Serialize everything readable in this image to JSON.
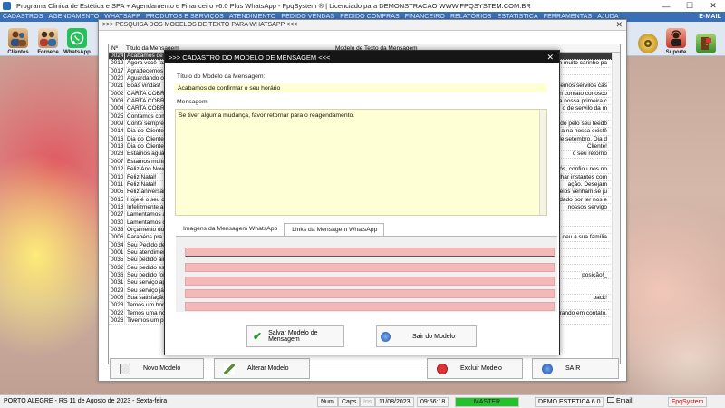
{
  "window": {
    "title": "Programa Clinica de Estética e SPA + Agendamento e Financeiro v6.0 Plus WhatsApp - FpqSystem ® | Licenciado para  DEMONSTRACAO WWW.FPQSYSTEM.COM.BR",
    "min": "—",
    "max": "☐",
    "close": "✕"
  },
  "menu": {
    "items": [
      "CADASTROS",
      "AGENDAMENTO",
      "WHATSAPP",
      "PRODUTOS E SERVIÇOS",
      "ATENDIMENTO",
      "PEDIDO VENDAS",
      "PEDIDO COMPRAS",
      "FINANCEIRO",
      "RELATÓRIOS",
      "ESTATISTICA",
      "FERRAMENTAS",
      "AJUDA"
    ],
    "email": "E-MAIL"
  },
  "toolbar": {
    "clientes": "Clientes",
    "fornece": "Fornece",
    "whatsapp": "WhatsApp",
    "suporte": "Suporte"
  },
  "search_window": {
    "title": ">>> PESQUISA DOS MODELOS DE TEXTO PARA WHATSAPP <<<",
    "close": "✕",
    "columns": {
      "no": "Nº",
      "title": "Titulo da Mensagem",
      "model": "Modelo de Texto da Mensagem"
    },
    "rows": [
      {
        "no": "0024",
        "title": "Acabamos de c",
        "right": "",
        "selected": true
      },
      {
        "no": "0019",
        "title": "Agora você faz",
        "right": "om muito carinho pa"
      },
      {
        "no": "0017",
        "title": "Agradecemos",
        "right": ""
      },
      {
        "no": "0020",
        "title": "Aguardando o s",
        "right": ""
      },
      {
        "no": "0021",
        "title": "Boas vindas!",
        "right": "ssemos servilos cas"
      },
      {
        "no": "0002",
        "title": "CARTA COBRA",
        "right": "n contato conosco"
      },
      {
        "no": "0003",
        "title": "CARTA COBRA",
        "right": "a nossa primeira c"
      },
      {
        "no": "0004",
        "title": "CARTA COBRA",
        "right": "o de servilo da m"
      },
      {
        "no": "0025",
        "title": "Contamos com a",
        "right": ""
      },
      {
        "no": "0009",
        "title": "Conte sempre c",
        "right": "dido pelo seu feedb"
      },
      {
        "no": "0014",
        "title": "Dia do Cliente",
        "right": "a na nossa existê"
      },
      {
        "no": "0016",
        "title": "Dia do Cliente",
        "right": "de setembro, Dia d"
      },
      {
        "no": "0013",
        "title": "Dia do Cliente!",
        "right": "Cliente!"
      },
      {
        "no": "0028",
        "title": "Estamos aguard",
        "right": "o seu retorno"
      },
      {
        "no": "0007",
        "title": "Estamos muito fe",
        "right": ""
      },
      {
        "no": "0012",
        "title": "Feliz Ano Novo!",
        "right": "nós, confiou nos no"
      },
      {
        "no": "0010",
        "title": "Feliz Natal!",
        "right": "ilhar instantes com"
      },
      {
        "no": "0011",
        "title": "Feliz Natal!",
        "right": "ação. Desejam"
      },
      {
        "no": "0005",
        "title": "Feliz aniversário",
        "right": "eios venham se ju"
      },
      {
        "no": "0015",
        "title": "Hoje é o seu dia",
        "right": "dado por ter nos e"
      },
      {
        "no": "0018",
        "title": "Infelizmente ain",
        "right": "nossos servigo"
      },
      {
        "no": "0027",
        "title": "Lamentamos a s",
        "right": ""
      },
      {
        "no": "0030",
        "title": "Lamentamos o c",
        "right": ""
      },
      {
        "no": "0033",
        "title": "Orçamento do s",
        "right": ""
      },
      {
        "no": "0006",
        "title": "Parabéns pra vo",
        "right": "deu à sua família"
      },
      {
        "no": "0034",
        "title": "Seu Pedido de",
        "right": ""
      },
      {
        "no": "0001",
        "title": "Seu atendimen",
        "right": ""
      },
      {
        "no": "0035",
        "title": "Seu pedido ainc",
        "right": ""
      },
      {
        "no": "0032",
        "title": "Seu pedido está",
        "right": ""
      },
      {
        "no": "0036",
        "title": "Seu pedido foi D",
        "right": "posição!_"
      },
      {
        "no": "0031",
        "title": "Seu serviço apr",
        "right": ""
      },
      {
        "no": "0029",
        "title": "Seu serviço já e",
        "right": ""
      },
      {
        "no": "0008",
        "title": "Sua satisfação é",
        "right": "back!"
      },
      {
        "no": "0023",
        "title": "Temos um horár",
        "right": ""
      },
      {
        "no": "0022",
        "title": "Temos uma not",
        "right": "rando em contato."
      },
      {
        "no": "0026",
        "title": "Tivemos um pro",
        "right": ""
      }
    ],
    "buttons": {
      "novo": "Novo Modelo",
      "alterar": "Alterar Modelo",
      "excluir": "Excluir Modelo",
      "sair": "SAIR"
    }
  },
  "modal": {
    "title": ">>> CADASTRO DO MODELO DE MENSAGEM <<<",
    "close": "✕",
    "title_label": "Título do Modelo da Mensagem:",
    "title_value": "Acabamos de confirmar o seu horário",
    "message_label": "Mensagem",
    "message_value": "Se tiver alguma mudança, favor retornar para o reagendamento.",
    "tabs": [
      "Imagens da Mensagem WhatsApp",
      "Links da Mensagem WhatsApp"
    ],
    "active_tab": 1,
    "save_button": "Salvar Modelo de Mensagem",
    "exit_button": "Sair do Modelo"
  },
  "status": {
    "location": "PORTO ALEGRE - RS 11 de Agosto de 2023 - Sexta-feira",
    "num": "Num",
    "caps": "Caps",
    "ins": "Ins",
    "date": "11/08/2023",
    "time": "09:56:18",
    "master": "MASTER",
    "company": "DEMO ESTETICA 6.0",
    "email": "Email",
    "brand": "FpqSystem"
  },
  "colors": {
    "menu_bg": "#3a6fb5",
    "modal_title_bg": "#161616",
    "input_bg": "#ffffd6",
    "link_row": "#f4b8b8",
    "master_green": "#22c32a"
  }
}
